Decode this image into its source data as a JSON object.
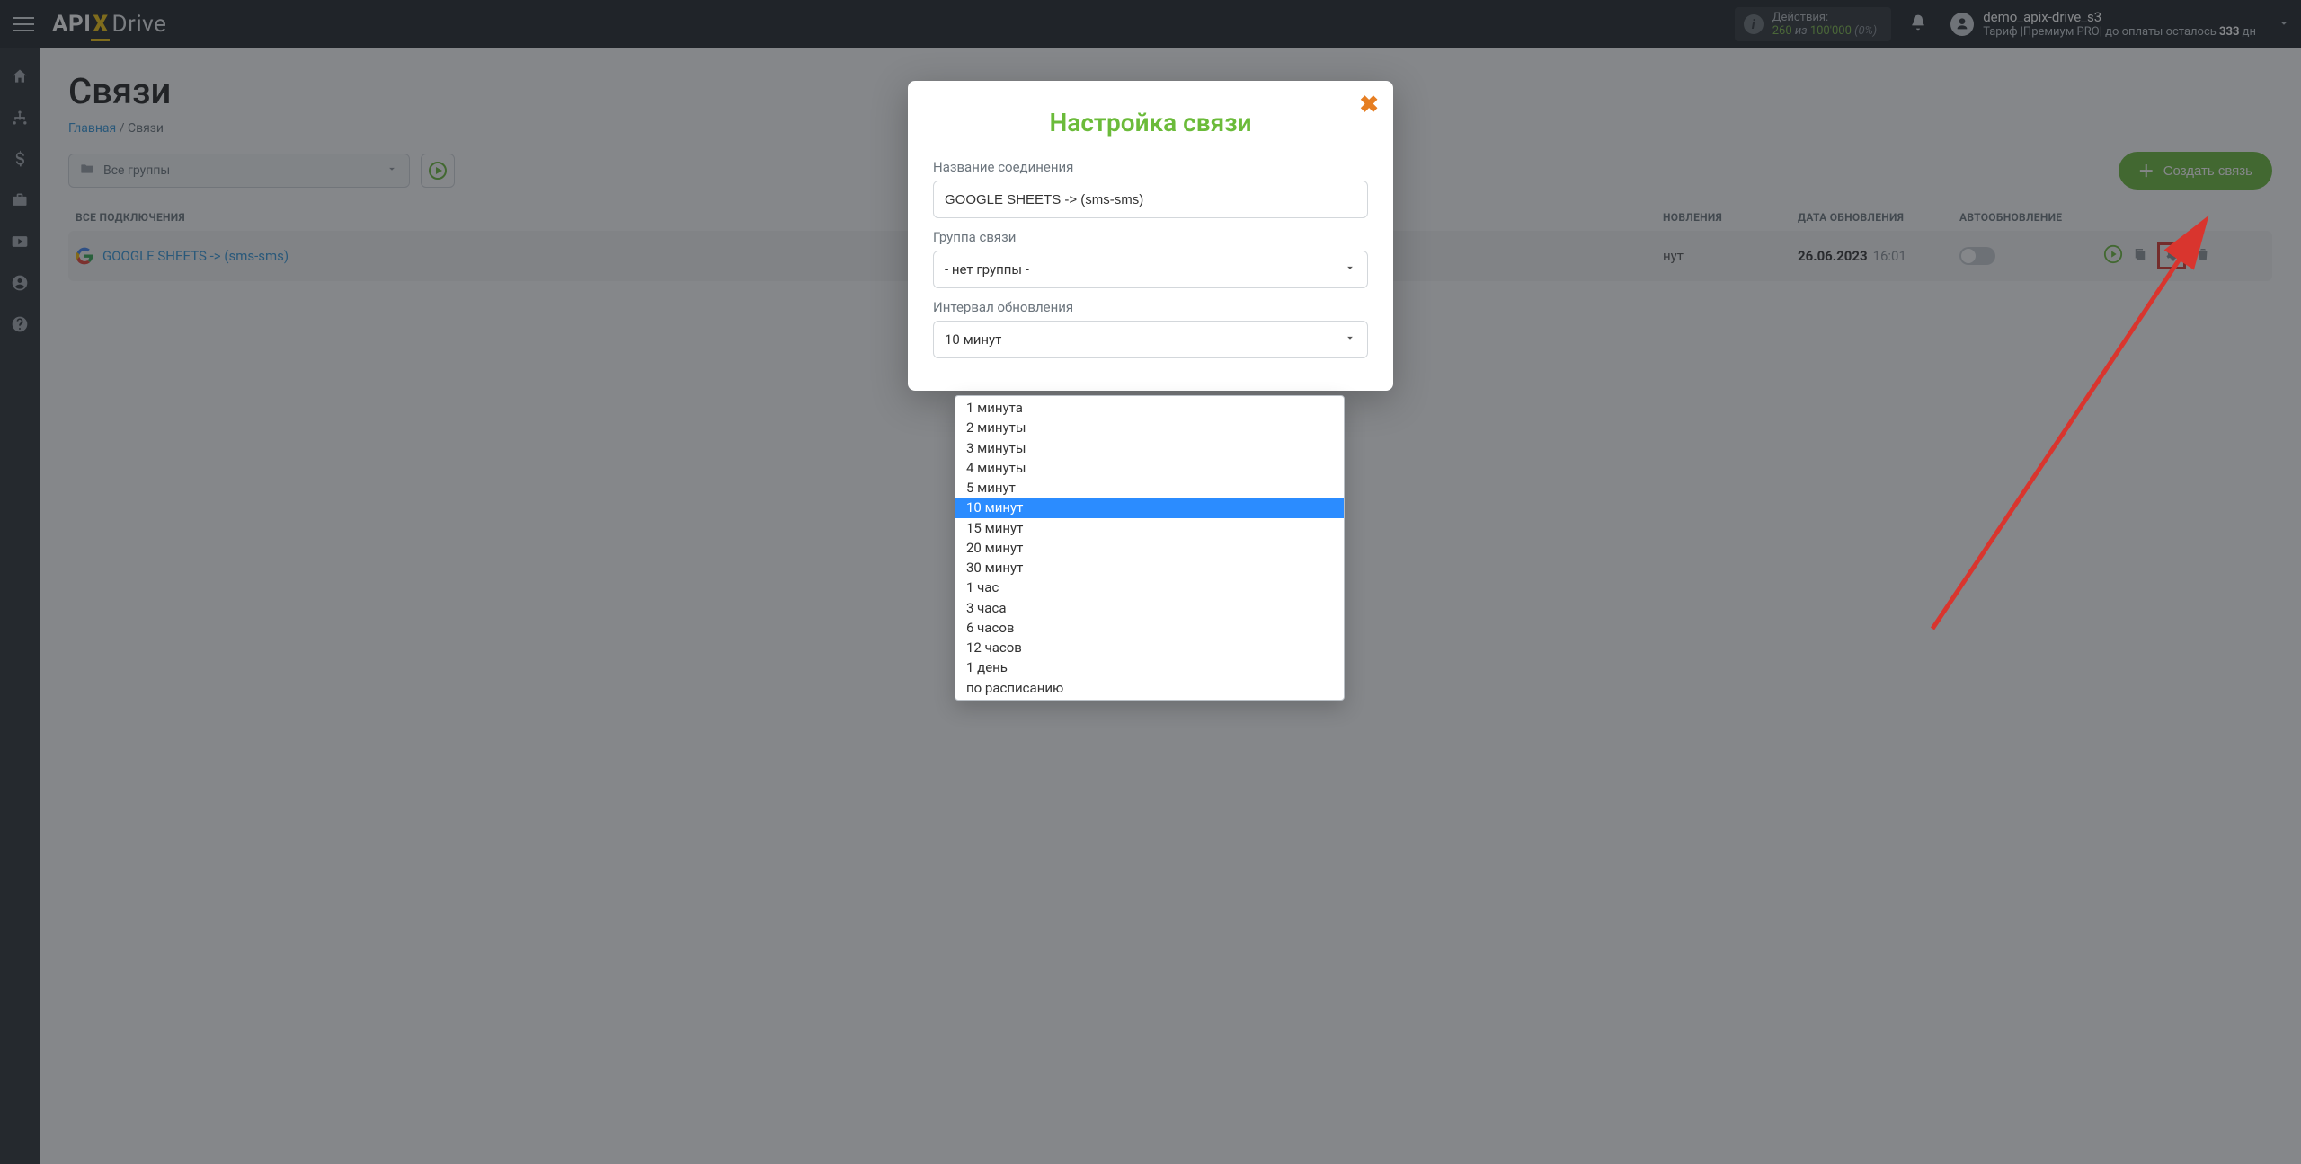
{
  "header": {
    "brand_api": "API",
    "brand_x": "X",
    "brand_drive": "Drive",
    "actions_label": "Действия:",
    "actions_count": "260",
    "actions_of": "из",
    "actions_max": "100'000",
    "actions_pct": "(0%)",
    "username": "demo_apix-drive_s3",
    "plan_prefix": "Тариф |Премиум PRO| до оплаты осталось ",
    "plan_days": "333",
    "plan_suffix": " дн"
  },
  "sidebar": {
    "items": [
      {
        "name": "home-icon"
      },
      {
        "name": "sitemap-icon"
      },
      {
        "name": "dollar-icon"
      },
      {
        "name": "briefcase-icon"
      },
      {
        "name": "video-icon"
      },
      {
        "name": "user-circle-icon"
      },
      {
        "name": "help-icon"
      }
    ]
  },
  "page": {
    "title": "Связи",
    "breadcrumb_home": "Главная",
    "breadcrumb_sep": "/",
    "breadcrumb_current": "Связи",
    "group_select_text": "Все группы",
    "create_btn": "Создать связь",
    "thead": {
      "all": "ВСЕ ПОДКЛЮЧЕНИЯ",
      "interval": "НОВЛЕНИЯ",
      "date": "ДАТА ОБНОВЛЕНИЯ",
      "auto": "АВТООБНОВЛЕНИЕ"
    },
    "row": {
      "name": "GOOGLE SHEETS -> (sms-sms)",
      "interval": "нут",
      "date": "26.06.2023",
      "time": "16:01"
    }
  },
  "modal": {
    "title": "Настройка связи",
    "label_name": "Название соединения",
    "value_name": "GOOGLE SHEETS -> (sms-sms)",
    "label_group": "Группа связи",
    "value_group": "- нет группы -",
    "label_interval": "Интервал обновления",
    "value_interval": "10 минут",
    "options": [
      "1 минута",
      "2 минуты",
      "3 минуты",
      "4 минуты",
      "5 минут",
      "10 минут",
      "15 минут",
      "20 минут",
      "30 минут",
      "1 час",
      "3 часа",
      "6 часов",
      "12 часов",
      "1 день",
      "по расписанию"
    ],
    "selected_option": "10 минут"
  }
}
